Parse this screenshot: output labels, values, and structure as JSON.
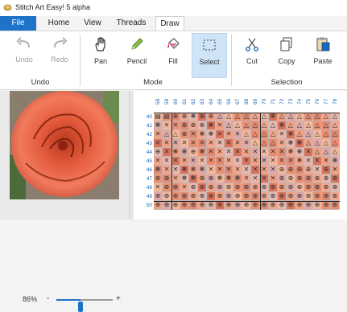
{
  "window": {
    "title": "Stitch Art Easy! 5 alpha"
  },
  "tabs": [
    {
      "label": "File"
    },
    {
      "label": "Home"
    },
    {
      "label": "View"
    },
    {
      "label": "Threads"
    },
    {
      "label": "Draw",
      "active": true
    }
  ],
  "ribbon": {
    "undo": {
      "label": "Undo"
    },
    "redo": {
      "label": "Redo"
    },
    "pan": {
      "label": "Pan"
    },
    "pencil": {
      "label": "Pencil"
    },
    "fill": {
      "label": "Fill"
    },
    "select": {
      "label": "Select"
    },
    "cut": {
      "label": "Cut"
    },
    "copy": {
      "label": "Copy"
    },
    "paste": {
      "label": "Paste"
    },
    "groups": {
      "undo": "Undo",
      "mode": "Mode",
      "selection": "Selection"
    }
  },
  "zoom": {
    "label": "86%",
    "minus": "-",
    "plus": "+",
    "level": 0.43
  },
  "grid": {
    "columns": [
      "58",
      "59",
      "60",
      "61",
      "62",
      "63",
      "64",
      "65",
      "66",
      "67",
      "68",
      "69",
      "70",
      "71",
      "72",
      "73",
      "74",
      "75",
      "76",
      "77",
      "78"
    ],
    "rows": [
      "40",
      "41",
      "42",
      "43",
      "44",
      "45",
      "46",
      "47",
      "48",
      "49",
      "50"
    ],
    "symbols": [
      "▤▤⊕⊕❋⊕⊕△△△△△△❋△△△△△△△",
      "❋✕✕⊕⊕⊕❋✕△△△△△△❋△△△△△△",
      "✕△△⊕✕❋❋✕✕✕△△△△✕❋△△△△△",
      "✕✕✕✕✕✕✕✕✕✕✕△△△✕❋❋△△△△",
      "⊕✕❋❋⊕❋✕✕✕✕✕✕✕✕✕❋❋✕△△△",
      "✕✕✕✕✕✕✕✕✕✕✕✕✕✕✕✕❋✕✕✕❋",
      "❋✕✕❋❋❋✕✕✕✕✕✕✕✕⊕⊕⊕⊕✕⊕✕",
      "⊕⊕✕❋❋⊕⊕❋❋❋✕✕✕✕⊕⊕⊕⊕⊕⊕⊕",
      "✕⊕⊕✕⊕⊕⊕⊕⊕⊕⊕⊕⊕⊕⊕⊕⊕⊕⊕⊕⊕",
      "⊕⊕⊕⊕⊕⊕⊕⊕⊕⊕⊕⊕⊕⊕⊕⊕⊕⊕⊕⊕⊕",
      "⊕⊕⊕⊕⊕⊕⊕⊕⊕⊕⊕⊕⊕⊕⊕⊕⊕⊕⊕⊕⊕"
    ],
    "colors": [
      "#f3b79b",
      "#f2a68c",
      "#efa182",
      "#ec8f70",
      "#e6b8ad",
      "#dfa9a7",
      "#e08a72",
      "#d9735b"
    ]
  }
}
